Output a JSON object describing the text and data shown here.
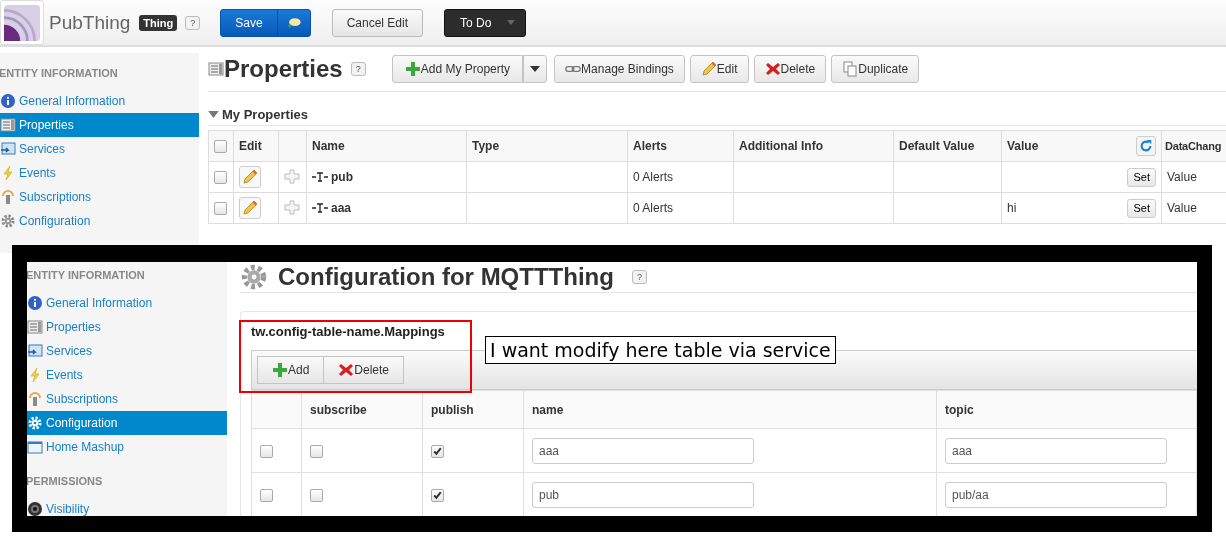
{
  "header": {
    "entity_name": "PubThing",
    "entity_type": "Thing",
    "help": "?",
    "buttons": [
      {
        "label": "Save",
        "kind": "primary"
      },
      {
        "label": "Cancel Edit",
        "kind": "default"
      },
      {
        "label": "To Do",
        "kind": "dark"
      }
    ]
  },
  "sidebar": {
    "title": "ENTITY INFORMATION",
    "items": [
      {
        "label": "General Information",
        "selected": false
      },
      {
        "label": "Properties",
        "selected": true
      },
      {
        "label": "Services",
        "selected": false
      },
      {
        "label": "Events",
        "selected": false
      },
      {
        "label": "Subscriptions",
        "selected": false
      },
      {
        "label": "Configuration",
        "selected": false
      }
    ]
  },
  "page": {
    "title": "Properties",
    "help": "?",
    "toolbar": [
      {
        "label": "Add My Property",
        "kind": "add",
        "has_menu": true
      },
      {
        "label": "Manage Bindings",
        "kind": "bindings",
        "has_menu": false
      },
      {
        "label": "Edit",
        "kind": "edit",
        "has_menu": false
      },
      {
        "label": "Delete",
        "kind": "delete",
        "has_menu": false
      },
      {
        "label": "Duplicate",
        "kind": "duplicate",
        "has_menu": false
      }
    ]
  },
  "section": {
    "title": "My Properties",
    "expanded": true
  },
  "table": {
    "header_checked": false,
    "columns": [
      "Edit",
      "Name",
      "Type",
      "Alerts",
      "Additional Info",
      "Default Value",
      "Value",
      "DataChang"
    ],
    "rows": [
      {
        "checked": false,
        "name": "pub",
        "alerts": "0 Alerts",
        "set_label": "Set",
        "data_change": "Value"
      },
      {
        "checked": false,
        "name": "aaa",
        "alerts": "0 Alerts",
        "value": "hi",
        "set_label": "Set",
        "data_change": "Value"
      }
    ]
  },
  "inset": {
    "sidebar": {
      "groups": [
        {
          "title": "ENTITY INFORMATION",
          "items": [
            {
              "label": "General Information",
              "selected": false
            },
            {
              "label": "Properties",
              "selected": false
            },
            {
              "label": "Services",
              "selected": false
            },
            {
              "label": "Events",
              "selected": false
            },
            {
              "label": "Subscriptions",
              "selected": false
            },
            {
              "label": "Configuration",
              "selected": true
            },
            {
              "label": "Home Mashup",
              "selected": false
            }
          ]
        },
        {
          "title": "PERMISSIONS",
          "items": [
            {
              "label": "Visibility",
              "selected": false
            }
          ]
        }
      ]
    },
    "title": "Configuration for MQTTThing",
    "help": "?",
    "table_name": "tw.config-table-name.Mappings",
    "toolbar": [
      {
        "label": "Add",
        "kind": "add"
      },
      {
        "label": "Delete",
        "kind": "delete"
      }
    ],
    "columns": [
      "subscribe",
      "publish",
      "name",
      "topic"
    ],
    "rows": [
      {
        "checked": false,
        "subscribe": false,
        "publish": true,
        "name": "aaa",
        "topic": "aaa"
      },
      {
        "checked": false,
        "subscribe": false,
        "publish": true,
        "name": "pub",
        "topic": "pub/aa"
      }
    ]
  },
  "annotation": {
    "note": "I want modify here table via service"
  }
}
